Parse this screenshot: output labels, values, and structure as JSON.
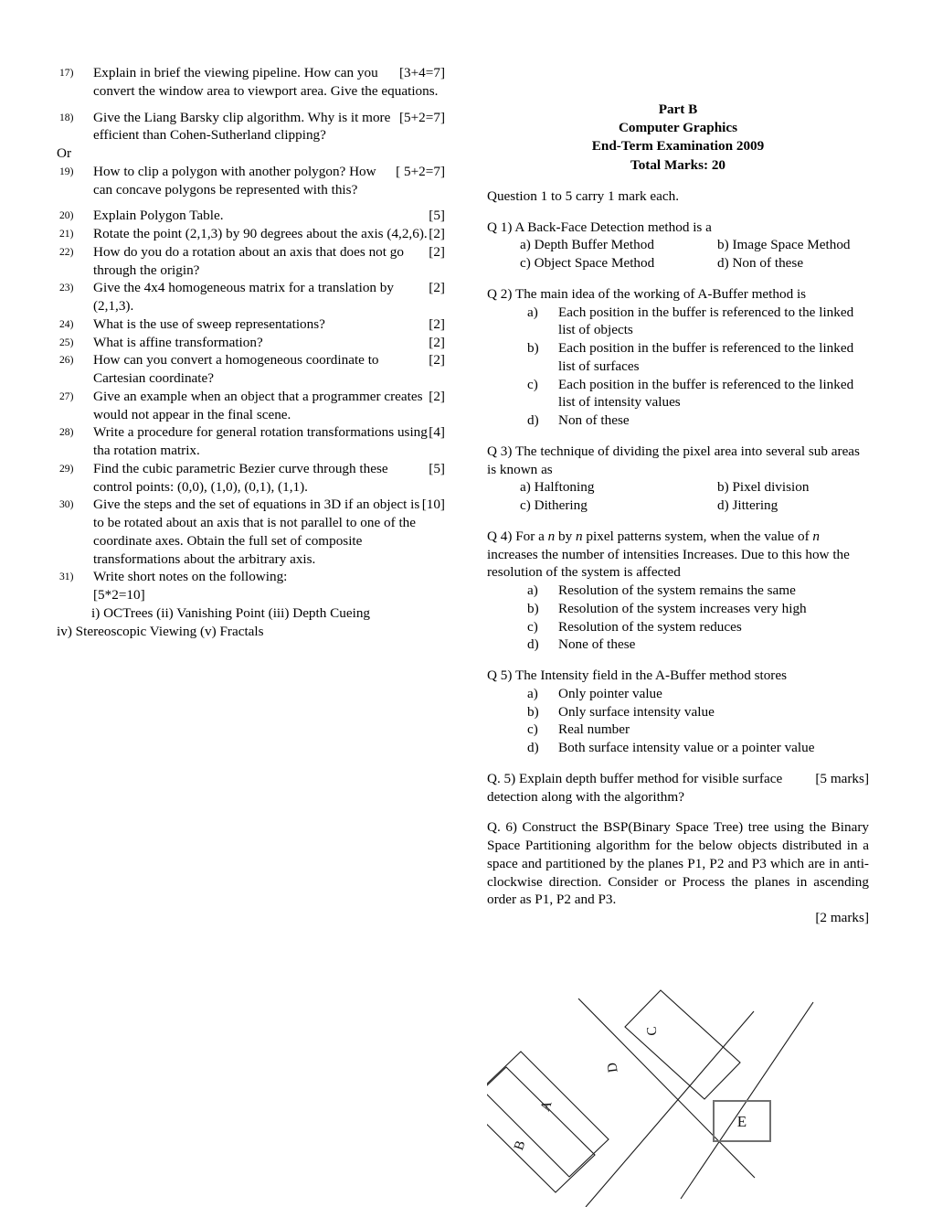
{
  "left_column": {
    "questions": [
      {
        "num": "17)",
        "text": "Explain in brief the viewing pipeline. How can you convert the window area to viewport area. Give the equations.",
        "marks": "[3+4=7]"
      },
      {
        "num": "18)",
        "text": "Give the Liang Barsky clip algorithm. Why is it more efficient than Cohen-Sutherland clipping?",
        "marks": "[5+2=7]"
      },
      {
        "num": "19)",
        "text": "How to clip a polygon with another polygon? How can concave polygons be represented with this?",
        "marks": "[ 5+2=7]"
      },
      {
        "num": "20)",
        "text": "Explain Polygon Table.",
        "marks": "[5]"
      },
      {
        "num": "21)",
        "text": "Rotate the point (2,1,3) by 90 degrees about the axis (4,2,6).",
        "marks": "[2]"
      },
      {
        "num": "22)",
        "text": "How do you do a rotation about an axis that does not go through the origin?",
        "marks": "[2]"
      },
      {
        "num": "23)",
        "text": "Give the 4x4 homogeneous matrix for a translation by (2,1,3).",
        "marks": "[2]"
      },
      {
        "num": "24)",
        "text": "What is the use of sweep representations?",
        "marks": "[2]"
      },
      {
        "num": "25)",
        "text": "What is affine transformation?",
        "marks": "[2]"
      },
      {
        "num": "26)",
        "text": "How can you convert a homogeneous coordinate to Cartesian coordinate?",
        "marks": "[2]"
      },
      {
        "num": "27)",
        "text": "Give an example when an object that a programmer creates would not appear in the final scene.",
        "marks": "[2]"
      },
      {
        "num": "28)",
        "text": "Write a procedure for general rotation transformations using tha rotation matrix.",
        "marks": "[4]"
      },
      {
        "num": "29)",
        "text": "Find the cubic parametric Bezier curve through these control points: (0,0), (1,0), (0,1), (1,1).",
        "marks": "[5]"
      },
      {
        "num": "30)",
        "text": "Give the steps and the set of equations in 3D if an object is to be rotated about an axis that is not parallel to one of the coordinate axes. Obtain the full set of composite transformations about the arbitrary axis.",
        "marks": "[10]"
      },
      {
        "num": "31)",
        "text": "Write short notes on the following:",
        "marks": ""
      }
    ],
    "or_label": "Or",
    "q31_marks": "[5*2=10]",
    "q31_sub_line1": "i) OCTrees   (ii) Vanishing Point    (iii) Depth Cueing",
    "q31_sub_line2": "iv) Stereoscopic Viewing (v) Fractals"
  },
  "right_column": {
    "header": {
      "line1": "Part B",
      "line2": "Computer Graphics",
      "line3": "End-Term Examination 2009",
      "line4": "Total Marks: 20"
    },
    "instruction": "Question 1 to 5 carry 1 mark each.",
    "mcq": [
      {
        "stem": "Q 1) A Back-Face Detection method is a",
        "layout": "two-column",
        "options": [
          {
            "label": "a)",
            "text": "Depth Buffer Method"
          },
          {
            "label": "b)",
            "text": "Image Space Method"
          },
          {
            "label": "c)",
            "text": "Object Space Method"
          },
          {
            "label": "d)",
            "text": "Non of these"
          }
        ]
      },
      {
        "stem": "Q 2) The main idea of the working of A-Buffer method is",
        "layout": "list",
        "options": [
          {
            "label": "a)",
            "text": "Each position in the buffer is referenced to the linked list of objects"
          },
          {
            "label": "b)",
            "text": "Each position in the buffer is referenced to the linked list of surfaces"
          },
          {
            "label": "c)",
            "text": "Each position in the buffer is referenced to the linked list of intensity values"
          },
          {
            "label": "d)",
            "text": "Non of these"
          }
        ]
      },
      {
        "stem": "Q 3) The technique of dividing the pixel area into several sub areas is known as",
        "layout": "two-column",
        "options": [
          {
            "label": "a)",
            "text": "Halftoning"
          },
          {
            "label": "b)",
            "text": "Pixel division"
          },
          {
            "label": "c)",
            "text": "Dithering"
          },
          {
            "label": "d)",
            "text": "Jittering"
          }
        ]
      },
      {
        "stem_pre": "Q 4) For a ",
        "stem_em1": "n",
        "stem_mid1": " by ",
        "stem_em2": "n",
        "stem_mid2": " pixel patterns system, when the value of ",
        "stem_em3": "n",
        "stem_post": " increases the number of intensities Increases. Due to this how the resolution of the system is affected",
        "layout": "list",
        "options": [
          {
            "label": "a)",
            "text": "Resolution of the system remains the same"
          },
          {
            "label": "b)",
            "text": "Resolution of the system increases very high"
          },
          {
            "label": "c)",
            "text": "Resolution of the system reduces"
          },
          {
            "label": "d)",
            "text": "None of these"
          }
        ]
      },
      {
        "stem": "Q 5) The Intensity field in the A-Buffer method stores",
        "layout": "list",
        "options": [
          {
            "label": "a)",
            "text": "Only pointer value"
          },
          {
            "label": "b)",
            "text": "Only surface intensity value"
          },
          {
            "label": "c)",
            "text": "Real number"
          },
          {
            "label": "d)",
            "text": "Both surface intensity value or a pointer value"
          }
        ]
      }
    ],
    "long_q5": {
      "text": "Q. 5) Explain depth buffer method for visible surface detection along with the algorithm?",
      "marks": "[5 marks]"
    },
    "long_q6": {
      "text": "Q. 6) Construct the BSP(Binary Space Tree) tree using the Binary Space Partitioning algorithm for the below objects distributed in a space and partitioned by the planes P1, P2 and P3 which are in anti-clockwise direction. Consider or Process the planes in ascending order as P1, P2 and P3.",
      "marks": "[2 marks]"
    }
  },
  "diagram": {
    "labels": {
      "a": "A",
      "b": "B",
      "c": "C",
      "d": "D",
      "e": "E"
    },
    "stroke_color": "#1a1a1a",
    "box_e_stroke": "#707070"
  }
}
